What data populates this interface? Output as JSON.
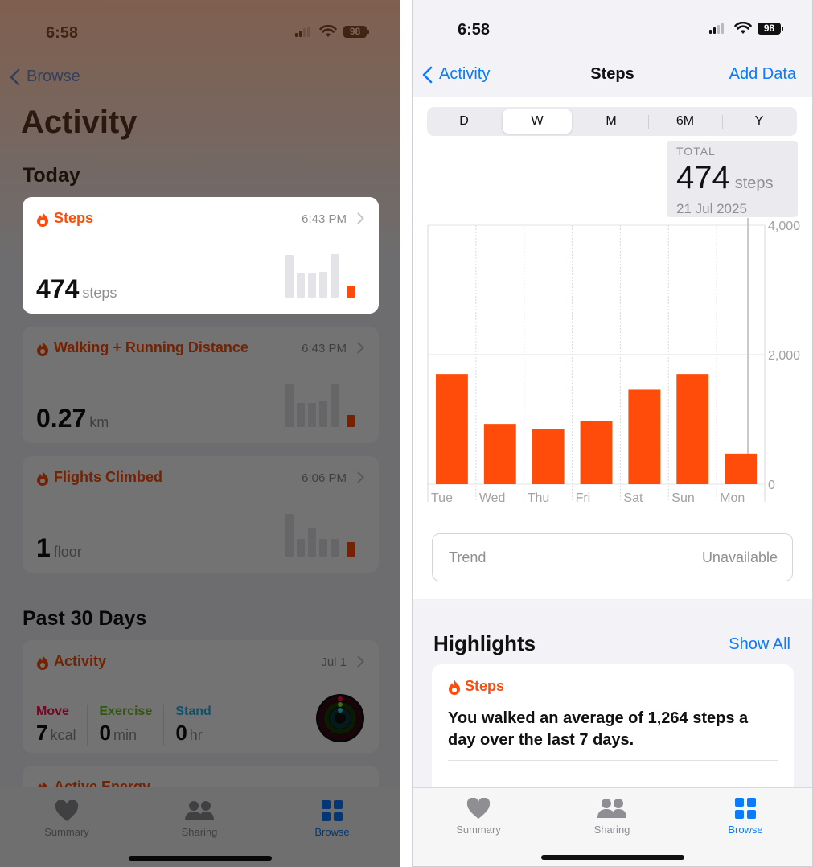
{
  "left": {
    "status": {
      "time": "6:58",
      "battery": "98"
    },
    "nav": {
      "back_label": "Browse"
    },
    "title": "Activity",
    "section_today": "Today",
    "steps_card": {
      "title": "Steps",
      "time": "6:43 PM",
      "value": "474",
      "unit": "steps",
      "bars": [
        0.95,
        0.53,
        0.53,
        0.58,
        0.96,
        0.27
      ]
    },
    "distance_card": {
      "title": "Walking + Running Distance",
      "time": "6:43 PM",
      "value": "0.27",
      "unit": "km",
      "bars": [
        0.95,
        0.53,
        0.53,
        0.58,
        0.96,
        0.27
      ]
    },
    "flights_card": {
      "title": "Flights Climbed",
      "time": "6:06 PM",
      "value": "1",
      "unit": "floor",
      "bars": [
        0.95,
        0.4,
        0.62,
        0.4,
        0.4,
        0.32
      ]
    },
    "section_past": "Past 30 Days",
    "activity_card": {
      "title": "Activity",
      "time": "Jul 1",
      "move": {
        "label": "Move",
        "value": "7",
        "unit": "kcal"
      },
      "exercise": {
        "label": "Exercise",
        "value": "0",
        "unit": "min"
      },
      "stand": {
        "label": "Stand",
        "value": "0",
        "unit": "hr"
      }
    },
    "partial_card_title": "Active Energy",
    "tabs": {
      "summary": "Summary",
      "sharing": "Sharing",
      "browse": "Browse"
    }
  },
  "right": {
    "status": {
      "time": "6:58",
      "battery": "98"
    },
    "nav": {
      "back_label": "Activity",
      "title": "Steps",
      "action": "Add Data"
    },
    "segments": [
      "D",
      "W",
      "M",
      "6M",
      "Y"
    ],
    "selected_segment": "W",
    "total": {
      "label": "TOTAL",
      "value": "474",
      "unit": "steps",
      "date": "21 Jul 2025"
    },
    "chart_data": {
      "type": "bar",
      "categories": [
        "Tue",
        "Wed",
        "Thu",
        "Fri",
        "Sat",
        "Sun",
        "Mon"
      ],
      "values": [
        1700,
        930,
        850,
        980,
        1460,
        1700,
        474
      ],
      "ylim": [
        0,
        4000
      ],
      "y_ticks": [
        "4,000",
        "2,000",
        "0"
      ],
      "selected_index": 6,
      "bar_color": "#ff4c0a"
    },
    "trend": {
      "label": "Trend",
      "value": "Unavailable"
    },
    "highlights": {
      "title": "Highlights",
      "show_all": "Show All",
      "card_title": "Steps",
      "text": "You walked an average of 1,264 steps a day over the last 7 days."
    },
    "tabs": {
      "summary": "Summary",
      "sharing": "Sharing",
      "browse": "Browse"
    }
  },
  "colors": {
    "accent": "#0a7aff",
    "activity": "#ff4c0a",
    "move": "#fa114f",
    "exercise": "#92e82a",
    "stand": "#1eeaef"
  }
}
